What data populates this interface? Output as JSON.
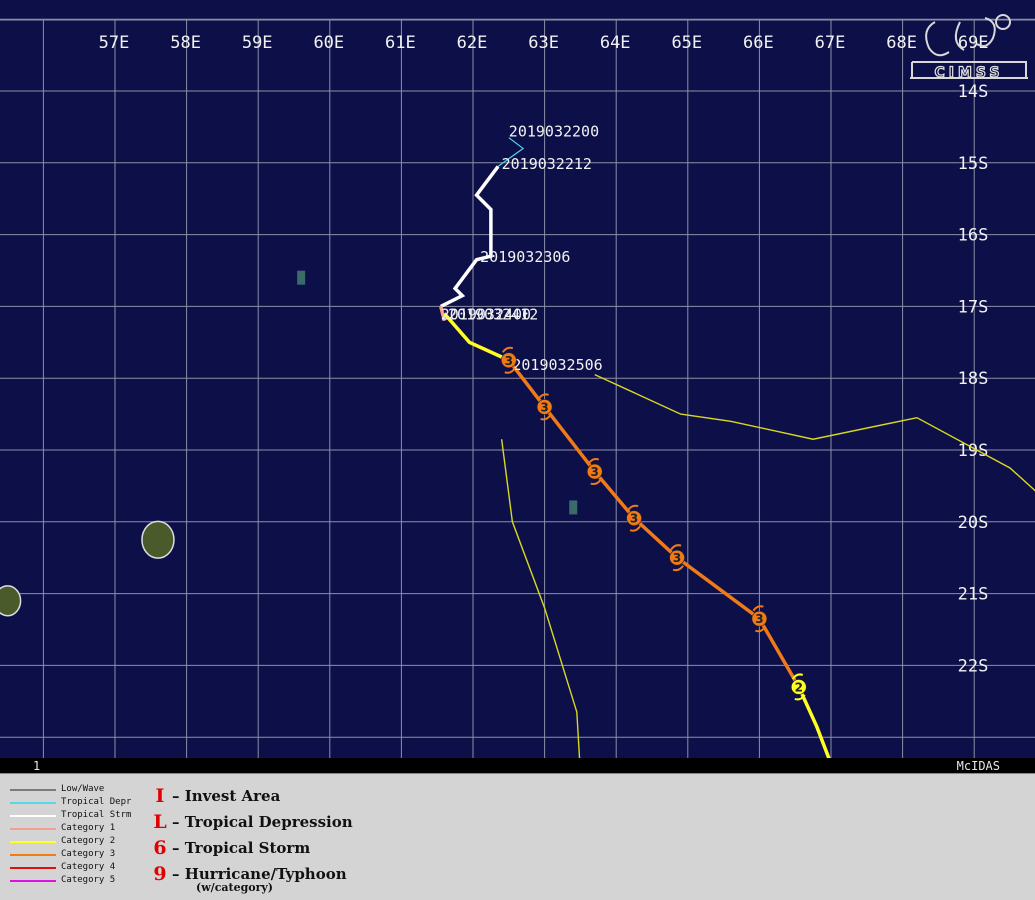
{
  "map": {
    "lon_labels": [
      "57E",
      "58E",
      "59E",
      "60E",
      "61E",
      "62E",
      "63E",
      "64E",
      "65E",
      "66E",
      "67E",
      "68E",
      "69E"
    ],
    "lat_labels": [
      "14S",
      "15S",
      "16S",
      "17S",
      "18S",
      "19S",
      "20S",
      "21S",
      "22S"
    ],
    "frame_label": "1",
    "source_label": "McIDAS",
    "logo_text": "CIMSS",
    "colors": {
      "ocean": "#0d1048",
      "grid": "#8b8fa6",
      "labels": "#f2f2f2",
      "tropical_depression": "#55d8e8",
      "tropical_storm": "#ffffff",
      "category_1": "#f4a090",
      "category_2": "#ffff22",
      "category_3": "#f07a18",
      "forecast_cone": "#d8d820"
    },
    "track_labels": [
      {
        "text": "2019032200",
        "lon": 62.5,
        "lat": 14.55
      },
      {
        "text": "2019032212",
        "lon": 62.4,
        "lat": 15.0
      },
      {
        "text": "2019032306",
        "lon": 62.1,
        "lat": 16.3
      },
      {
        "text": "2019032400",
        "lon": 61.55,
        "lat": 17.1
      },
      {
        "text": "2019032412",
        "lon": 61.65,
        "lat": 17.1
      },
      {
        "text": "2019032506",
        "lon": 62.55,
        "lat": 17.8
      }
    ],
    "track": [
      {
        "cat": "tropical_depression",
        "points": [
          [
            62.5,
            14.65
          ],
          [
            62.7,
            14.8
          ],
          [
            62.35,
            15.05
          ]
        ]
      },
      {
        "cat": "tropical_storm",
        "points": [
          [
            62.35,
            15.05
          ],
          [
            62.05,
            15.45
          ],
          [
            62.25,
            15.65
          ],
          [
            62.25,
            16.3
          ],
          [
            62.05,
            16.35
          ],
          [
            61.75,
            16.75
          ],
          [
            61.85,
            16.85
          ],
          [
            61.55,
            17.0
          ]
        ]
      },
      {
        "cat": "category_1",
        "points": [
          [
            61.55,
            17.0
          ],
          [
            61.6,
            17.2
          ]
        ]
      },
      {
        "cat": "category_2",
        "points": [
          [
            61.6,
            17.1
          ],
          [
            61.95,
            17.5
          ],
          [
            62.5,
            17.75
          ]
        ]
      },
      {
        "cat": "category_3",
        "points": [
          [
            62.5,
            17.75
          ],
          [
            63.0,
            18.4
          ],
          [
            63.7,
            19.3
          ],
          [
            64.25,
            19.95
          ],
          [
            64.85,
            20.5
          ],
          [
            66.0,
            21.35
          ],
          [
            66.55,
            22.3
          ]
        ]
      },
      {
        "cat": "category_2",
        "points": [
          [
            66.55,
            22.3
          ],
          [
            66.8,
            22.85
          ],
          [
            67.05,
            23.5
          ]
        ]
      }
    ],
    "storm_markers": [
      {
        "lon": 62.5,
        "lat": 17.75,
        "cat": "category_3",
        "label": "3"
      },
      {
        "lon": 63.0,
        "lat": 18.4,
        "cat": "category_3",
        "label": "3"
      },
      {
        "lon": 63.7,
        "lat": 19.3,
        "cat": "category_3",
        "label": "3"
      },
      {
        "lon": 64.25,
        "lat": 19.95,
        "cat": "category_3",
        "label": "3"
      },
      {
        "lon": 64.85,
        "lat": 20.5,
        "cat": "category_3",
        "label": "3"
      },
      {
        "lon": 66.0,
        "lat": 21.35,
        "cat": "category_3",
        "label": "3"
      },
      {
        "lon": 66.55,
        "lat": 22.3,
        "cat": "category_2",
        "label": "2"
      }
    ],
    "forecast_lines": [
      [
        [
          62.4,
          18.85
        ],
        [
          62.55,
          20.0
        ],
        [
          63.0,
          21.2
        ],
        [
          63.45,
          22.65
        ],
        [
          63.5,
          23.5
        ]
      ],
      [
        [
          63.7,
          17.95
        ],
        [
          64.9,
          18.5
        ],
        [
          65.6,
          18.6
        ],
        [
          66.75,
          18.85
        ],
        [
          68.2,
          18.55
        ],
        [
          69.5,
          19.25
        ],
        [
          70.0,
          19.7
        ]
      ]
    ],
    "islands": [
      {
        "name": "mauritius-island",
        "lon": 57.6,
        "lat": 20.25
      },
      {
        "name": "reunion-island",
        "lon": 55.5,
        "lat": 21.1
      },
      {
        "name": "tromelin-island",
        "lon": 59.6,
        "lat": 16.6
      },
      {
        "name": "small-islet",
        "lon": 63.4,
        "lat": 19.8
      }
    ]
  },
  "legend": {
    "track_types": [
      {
        "label": "Low/Wave",
        "color": "#7a7a7a"
      },
      {
        "label": "Tropical Depr",
        "color": "#55d8e8"
      },
      {
        "label": "Tropical Strm",
        "color": "#ffffff"
      },
      {
        "label": "Category 1",
        "color": "#f4a090"
      },
      {
        "label": "Category 2",
        "color": "#ffff22"
      },
      {
        "label": "Category 3",
        "color": "#f07a18"
      },
      {
        "label": "Category 4",
        "color": "#e01010"
      },
      {
        "label": "Category 5",
        "color": "#e010e0"
      }
    ],
    "symbols": [
      {
        "icon": "invest-area-icon",
        "glyph": "I",
        "label": "– Invest Area"
      },
      {
        "icon": "tropical-depression-icon",
        "glyph": "L",
        "label": "– Tropical Depression"
      },
      {
        "icon": "tropical-storm-icon",
        "glyph": "6",
        "label": "– Tropical Storm"
      },
      {
        "icon": "hurricane-typhoon-icon",
        "glyph": "9",
        "label": "– Hurricane/Typhoon"
      }
    ],
    "note": "(w/category)"
  }
}
